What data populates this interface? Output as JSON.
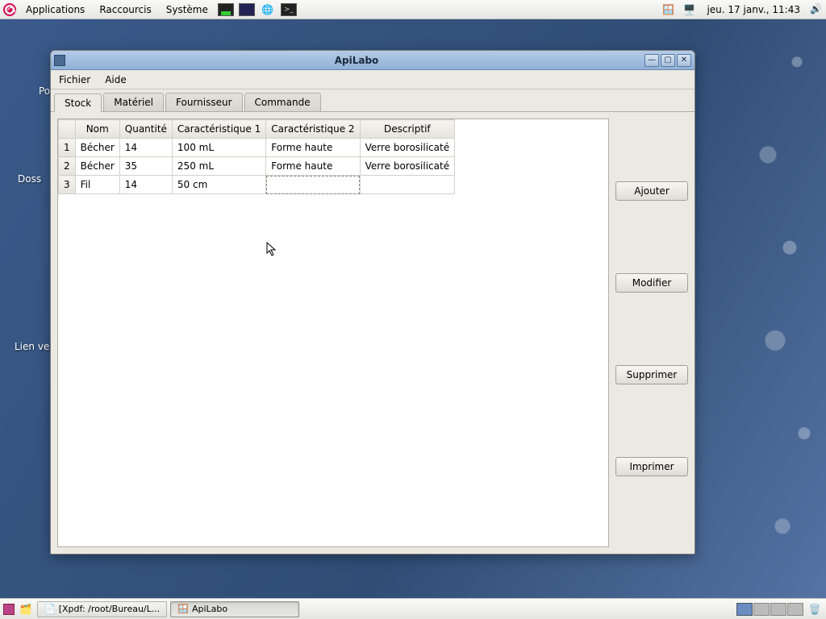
{
  "top_panel": {
    "menus": [
      "Applications",
      "Raccourcis",
      "Système"
    ],
    "clock": "jeu. 17 janv., 11:43"
  },
  "bottom_panel": {
    "tasks": [
      {
        "label": "[Xpdf: /root/Bureau/L...",
        "active": false
      },
      {
        "label": "ApiLabo",
        "active": true
      }
    ]
  },
  "window": {
    "title": "ApiLabo",
    "menus": [
      "Fichier",
      "Aide"
    ],
    "tabs": [
      "Stock",
      "Matériel",
      "Fournisseur",
      "Commande"
    ],
    "active_tab": 0,
    "columns": [
      "",
      "Nom",
      "Quantité",
      "Caractéristique 1",
      "Caractéristique 2",
      "Descriptif"
    ],
    "rows": [
      {
        "n": "1",
        "nom": "Bécher",
        "qte": "14",
        "c1": "100 mL",
        "c2": "Forme haute",
        "desc": "Verre borosilicaté"
      },
      {
        "n": "2",
        "nom": "Bécher",
        "qte": "35",
        "c1": "250 mL",
        "c2": "Forme haute",
        "desc": "Verre borosilicaté"
      },
      {
        "n": "3",
        "nom": "Fil",
        "qte": "14",
        "c1": "50 cm",
        "c2": "",
        "desc": ""
      }
    ],
    "buttons": [
      "Ajouter",
      "Modifier",
      "Supprimer",
      "Imprimer"
    ]
  },
  "desktop_labels": {
    "pos": "Pos",
    "dos": "Doss",
    "lien": "Lien ve"
  }
}
